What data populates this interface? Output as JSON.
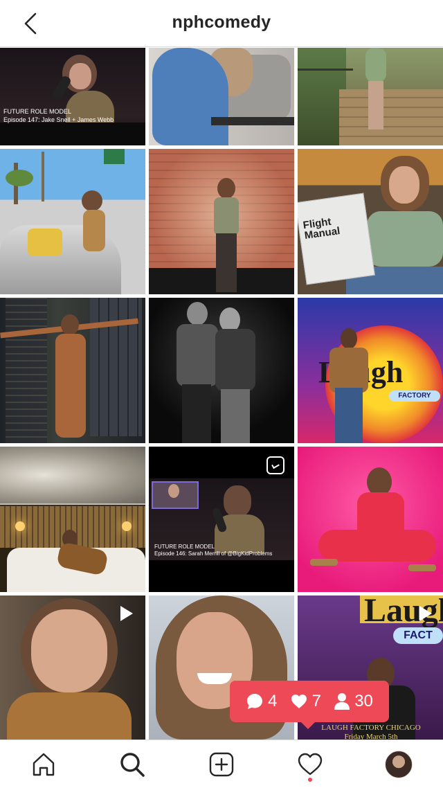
{
  "header": {
    "title": "nphcomedy"
  },
  "posts": [
    {
      "caption_line1": "FUTURE ROLE MODEL",
      "caption_line2": "Episode 147: Jake Snell + James Webb"
    },
    {
      "book_line1": "Flight",
      "book_line2": "Manual"
    },
    {
      "sign_line1": "Laugh",
      "sign_line2": "FACTORY"
    },
    {
      "caption_line1": "FUTURE ROLE MODEL",
      "caption_line2": "Episode 146: Sarah Merrill of @BigKidProblems"
    },
    {
      "sign_line1": "Laugh",
      "sign_line2": "FACT"
    }
  ],
  "notification": {
    "comments": "4",
    "likes": "7",
    "followers": "30"
  },
  "bottom_caption": {
    "line1": "LAUGH FACTORY CHICAGO",
    "line2": "Friday March 5th"
  },
  "tabbar": {
    "items": [
      "home-icon",
      "search-icon",
      "new-post-icon",
      "activity-heart-icon",
      "profile-avatar"
    ]
  },
  "colors": {
    "notification": "#ed4956",
    "accent_text": "#262626"
  }
}
